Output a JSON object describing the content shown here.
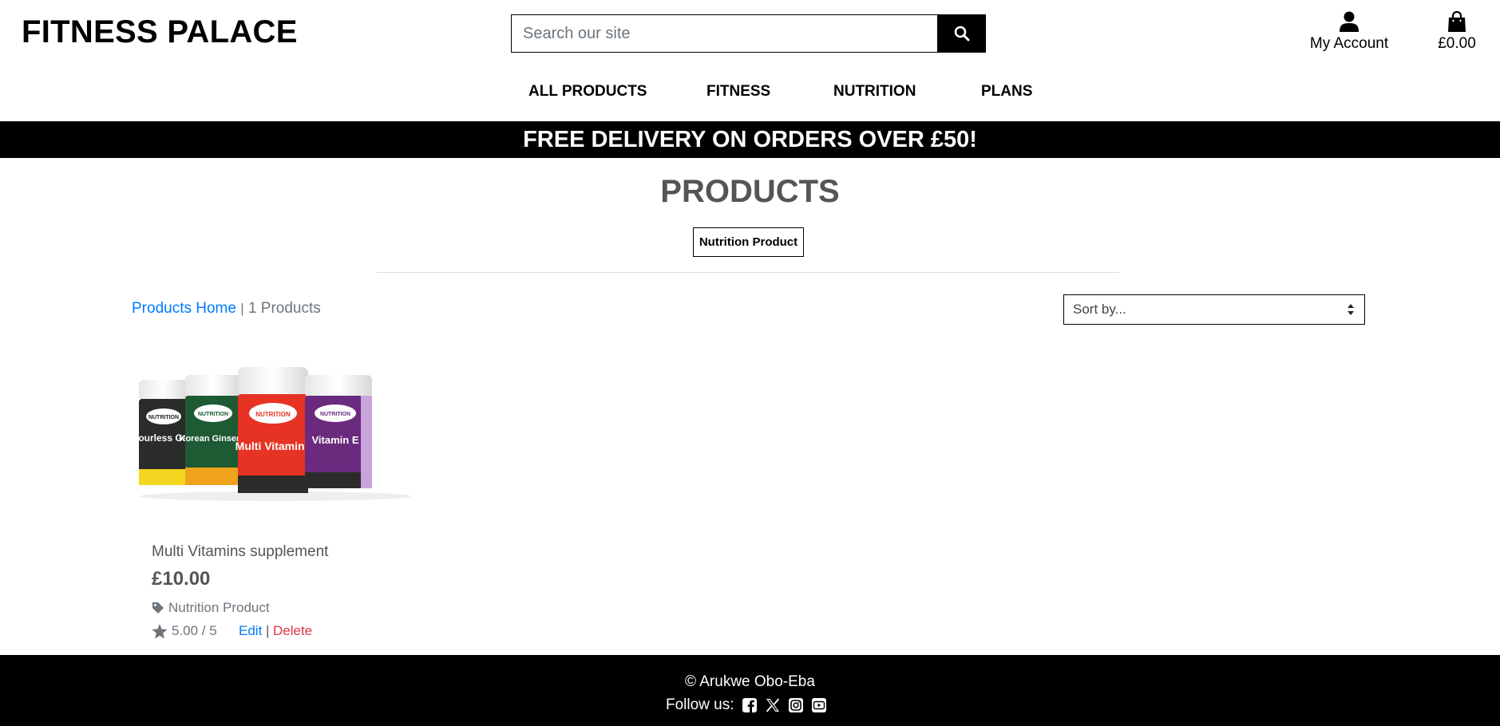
{
  "header": {
    "logo": "FITNESS PALACE",
    "search_placeholder": "Search our site",
    "account_label": "My Account",
    "cart_total": "£0.00"
  },
  "nav": {
    "items": [
      "ALL PRODUCTS",
      "FITNESS",
      "NUTRITION",
      "PLANS"
    ]
  },
  "banner": {
    "text": "FREE DELIVERY ON ORDERS OVER £50!"
  },
  "page": {
    "title": "PRODUCTS",
    "category_filter": "Nutrition Product",
    "breadcrumb_link": "Products Home",
    "breadcrumb_sep": "|",
    "product_count": "1 Products",
    "sort_placeholder": "Sort by..."
  },
  "products": [
    {
      "name": "Multi Vitamins supplement",
      "price": "£10.00",
      "category": "Nutrition Product",
      "rating": "5.00 / 5",
      "edit_label": "Edit",
      "pipe": "|",
      "delete_label": "Delete",
      "image_labels": {
        "brand": "NUTRITION",
        "jar1": "Odourless Garlic",
        "jar2": "Korean Ginseng",
        "jar3": "Multi Vitamins",
        "jar4": "Vitamin E"
      }
    }
  ],
  "footer": {
    "copyright": "© Arukwe Obo-Eba",
    "follow_label": "Follow us:",
    "social": [
      "facebook-icon",
      "x-icon",
      "instagram-icon",
      "youtube-icon"
    ]
  },
  "colors": {
    "link": "#007bff",
    "delete": "#dc3545",
    "banner_bg": "#000000",
    "muted": "#6c757d"
  }
}
